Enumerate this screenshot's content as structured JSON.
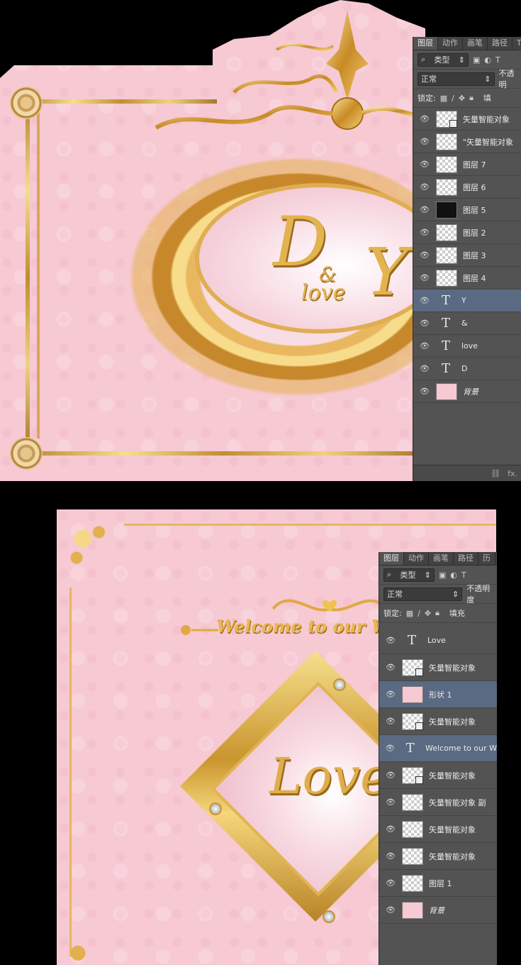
{
  "top_art": {
    "monogram_big": "D",
    "monogram_amp": "&",
    "monogram_love": "love",
    "monogram_y": "Y"
  },
  "bottom_art": {
    "welcome_text": "Welcome to our W",
    "love_text": "Love"
  },
  "panel1": {
    "tabs": [
      "图层",
      "动作",
      "画笔",
      "路径",
      "T"
    ],
    "filter_label": "类型",
    "blend_mode": "正常",
    "opacity_label": "不透明",
    "lock_label": "锁定:",
    "fill_label": "填",
    "layers": [
      {
        "name": "矢量智能对象",
        "kind": "smart",
        "selected": false
      },
      {
        "name": "\"矢量智能对象",
        "kind": "pixel",
        "selected": false
      },
      {
        "name": "图层 7",
        "kind": "pixel",
        "selected": false
      },
      {
        "name": "图层 6",
        "kind": "pixel",
        "selected": false
      },
      {
        "name": "图层 5",
        "kind": "black",
        "selected": false
      },
      {
        "name": "图层 2",
        "kind": "pixel",
        "selected": false
      },
      {
        "name": "图层 3",
        "kind": "pixel",
        "selected": false
      },
      {
        "name": "图层 4",
        "kind": "pixel",
        "selected": false
      },
      {
        "name": "Y",
        "kind": "text",
        "selected": true
      },
      {
        "name": "&",
        "kind": "text",
        "selected": false
      },
      {
        "name": "love",
        "kind": "text",
        "selected": false
      },
      {
        "name": "D",
        "kind": "text",
        "selected": false
      },
      {
        "name": "背景",
        "kind": "pink",
        "selected": false
      }
    ],
    "footer_fx": "fx."
  },
  "panel2": {
    "tabs": [
      "图层",
      "动作",
      "画笔",
      "路径",
      "历"
    ],
    "filter_label": "类型",
    "blend_mode": "正常",
    "opacity_label": "不透明度",
    "lock_label": "锁定:",
    "fill_label": "填充",
    "layers": [
      {
        "name": "Love",
        "kind": "text",
        "selected": false
      },
      {
        "name": "矢量智能对象",
        "kind": "smart",
        "selected": false
      },
      {
        "name": "形状 1",
        "kind": "pink",
        "selected": true
      },
      {
        "name": "矢量智能对象",
        "kind": "smart",
        "selected": false
      },
      {
        "name": "Welcome to our W",
        "kind": "text",
        "selected": true
      },
      {
        "name": "矢量智能对象",
        "kind": "smart",
        "selected": false
      },
      {
        "name": "矢量智能对象 副",
        "kind": "pixel",
        "selected": false
      },
      {
        "name": "矢量智能对象",
        "kind": "pixel",
        "selected": false
      },
      {
        "name": "矢量智能对象",
        "kind": "pixel",
        "selected": false
      },
      {
        "name": "图层 1",
        "kind": "pixel",
        "selected": false
      },
      {
        "name": "背景",
        "kind": "pink",
        "selected": false
      }
    ]
  }
}
